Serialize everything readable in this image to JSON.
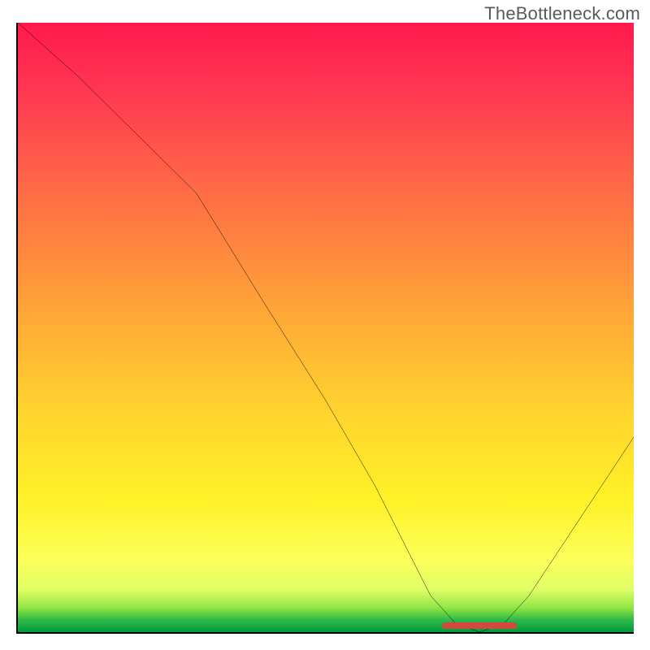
{
  "watermark": "TheBottleneck.com",
  "colors": {
    "gradient_top": "#ff1a4d",
    "gradient_mid_orange": "#ff843f",
    "gradient_yellow": "#fff127",
    "gradient_green": "#009a3c",
    "curve": "#000000",
    "axis": "#000000",
    "marker": "#d24a3f"
  },
  "chart_data": {
    "type": "line",
    "title": "",
    "xlabel": "",
    "ylabel": "",
    "xlim": [
      0,
      100
    ],
    "ylim": [
      0,
      100
    ],
    "legend": false,
    "grid": false,
    "x": [
      0,
      10,
      20,
      29,
      40,
      50,
      58,
      63,
      67,
      71,
      75,
      79,
      83,
      100
    ],
    "values": [
      100,
      91,
      81,
      72,
      54,
      38,
      24,
      14,
      6,
      1.5,
      0,
      1.5,
      6,
      32
    ],
    "minimum": {
      "x_range": [
        69,
        81
      ],
      "y": 0
    },
    "notes": "V-shaped bottleneck curve over a red-to-green vertical gradient background. X axis represents a configuration parameter; Y axis represents bottleneck severity (higher = worse / red, 0 = optimal / green). The flat marker at y≈0 indicates the optimal range."
  }
}
